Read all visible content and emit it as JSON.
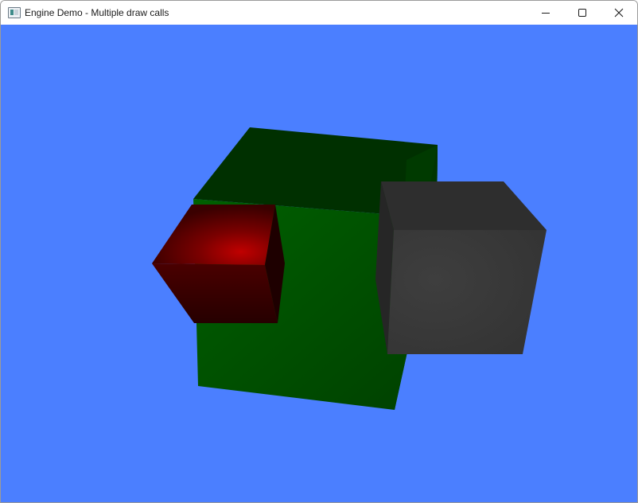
{
  "window": {
    "title": "Engine Demo - Multiple draw calls",
    "icon": "app-window-icon"
  },
  "caption_buttons": {
    "minimize": "minimize-icon",
    "maximize": "maximize-icon",
    "close": "close-icon"
  },
  "scene": {
    "background_color": "#4b7fff",
    "objects": [
      {
        "name": "green-cube",
        "color": "#0a5a0a"
      },
      {
        "name": "red-cube",
        "color": "#a80000"
      },
      {
        "name": "gray-cube",
        "color": "#3a3a3a"
      }
    ]
  }
}
